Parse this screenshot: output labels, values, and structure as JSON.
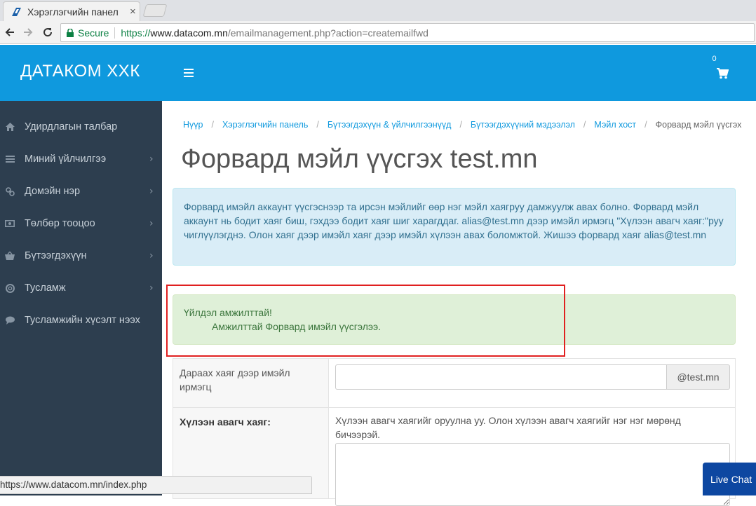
{
  "browser": {
    "tab_title": "Хэрэглэгчийн панел",
    "tab_close": "×",
    "secure_label": "Secure",
    "url_protocol": "https://",
    "url_host": "www.datacom.mn",
    "url_path": "/emailmanagement.php?action=createmailfwd",
    "status_url": "https://www.datacom.mn/index.php"
  },
  "header": {
    "brand": "ДАТАКОМ ХХК",
    "cart_count": "0"
  },
  "sidebar": {
    "items": [
      {
        "label": "Удирдлагын талбар",
        "icon": "home-icon",
        "has_children": false
      },
      {
        "label": "Миний үйлчилгээ",
        "icon": "list-icon",
        "has_children": true
      },
      {
        "label": "Домэйн нэр",
        "icon": "link-icon",
        "has_children": true
      },
      {
        "label": "Төлбөр тооцоо",
        "icon": "money-icon",
        "has_children": true
      },
      {
        "label": "Бүтээгдэхүүн",
        "icon": "basket-icon",
        "has_children": true
      },
      {
        "label": "Тусламж",
        "icon": "lifebuoy-icon",
        "has_children": true
      },
      {
        "label": "Тусламжийн хүсэлт нээх",
        "icon": "comment-icon",
        "has_children": false
      }
    ],
    "chevron": "›"
  },
  "breadcrumb": {
    "items": [
      "Нүүр",
      "Хэрэглэгчийн панель",
      "Бүтээгдэхүүн & үйлчилгээнүүд",
      "Бүтээгдэхүүний мэдээлэл",
      "Мэйл хост"
    ],
    "current": "Форвард мэйл үүсгэх",
    "separator": "/"
  },
  "page_title": "Форвард мэйл үүсгэх test.mn",
  "info_text": "Форвард имэйл аккаунт үүсгэснээр та ирсэн мэйлийг өөр нэг мэйл хаягруу дамжуулж авах болно. Форвард мэйл аккаунт нь бодит хаяг биш, гэхдээ бодит хаяг шиг харагддаг. alias@test.mn дээр имэйл ирмэгц \"Хүлээн авагч хаяг:\"руу чиглүүлэгднэ. Олон хаяг дээр имэйл хаяг дээр имэйл хүлээн авах боломжтой. Жишээ форвард хаяг alias@test.mn",
  "success": {
    "title": "Үйлдэл амжилттай!",
    "message": "Амжилттай Форвард имэйл үүсгэлээ."
  },
  "form": {
    "address_label": "Дараах хаяг дээр имэйл ирмэгц",
    "address_value": "",
    "domain_suffix": "@test.mn",
    "recipient_label": "Хүлээн авагч хаяг:",
    "recipient_help": "Хүлээн авагч хаягийг оруулна уу. Олон хүлээн авагч хаягийг нэг нэг мөрөнд бичээрэй.",
    "recipient_value": ""
  },
  "live_chat": "Live Chat",
  "colors": {
    "header_blue": "#0f99de",
    "sidebar_bg": "#2d3e4f",
    "info_bg": "#d9edf7",
    "success_bg": "#dff0d8",
    "highlight": "#e02020",
    "live_chat_bg": "#0d47a1"
  }
}
